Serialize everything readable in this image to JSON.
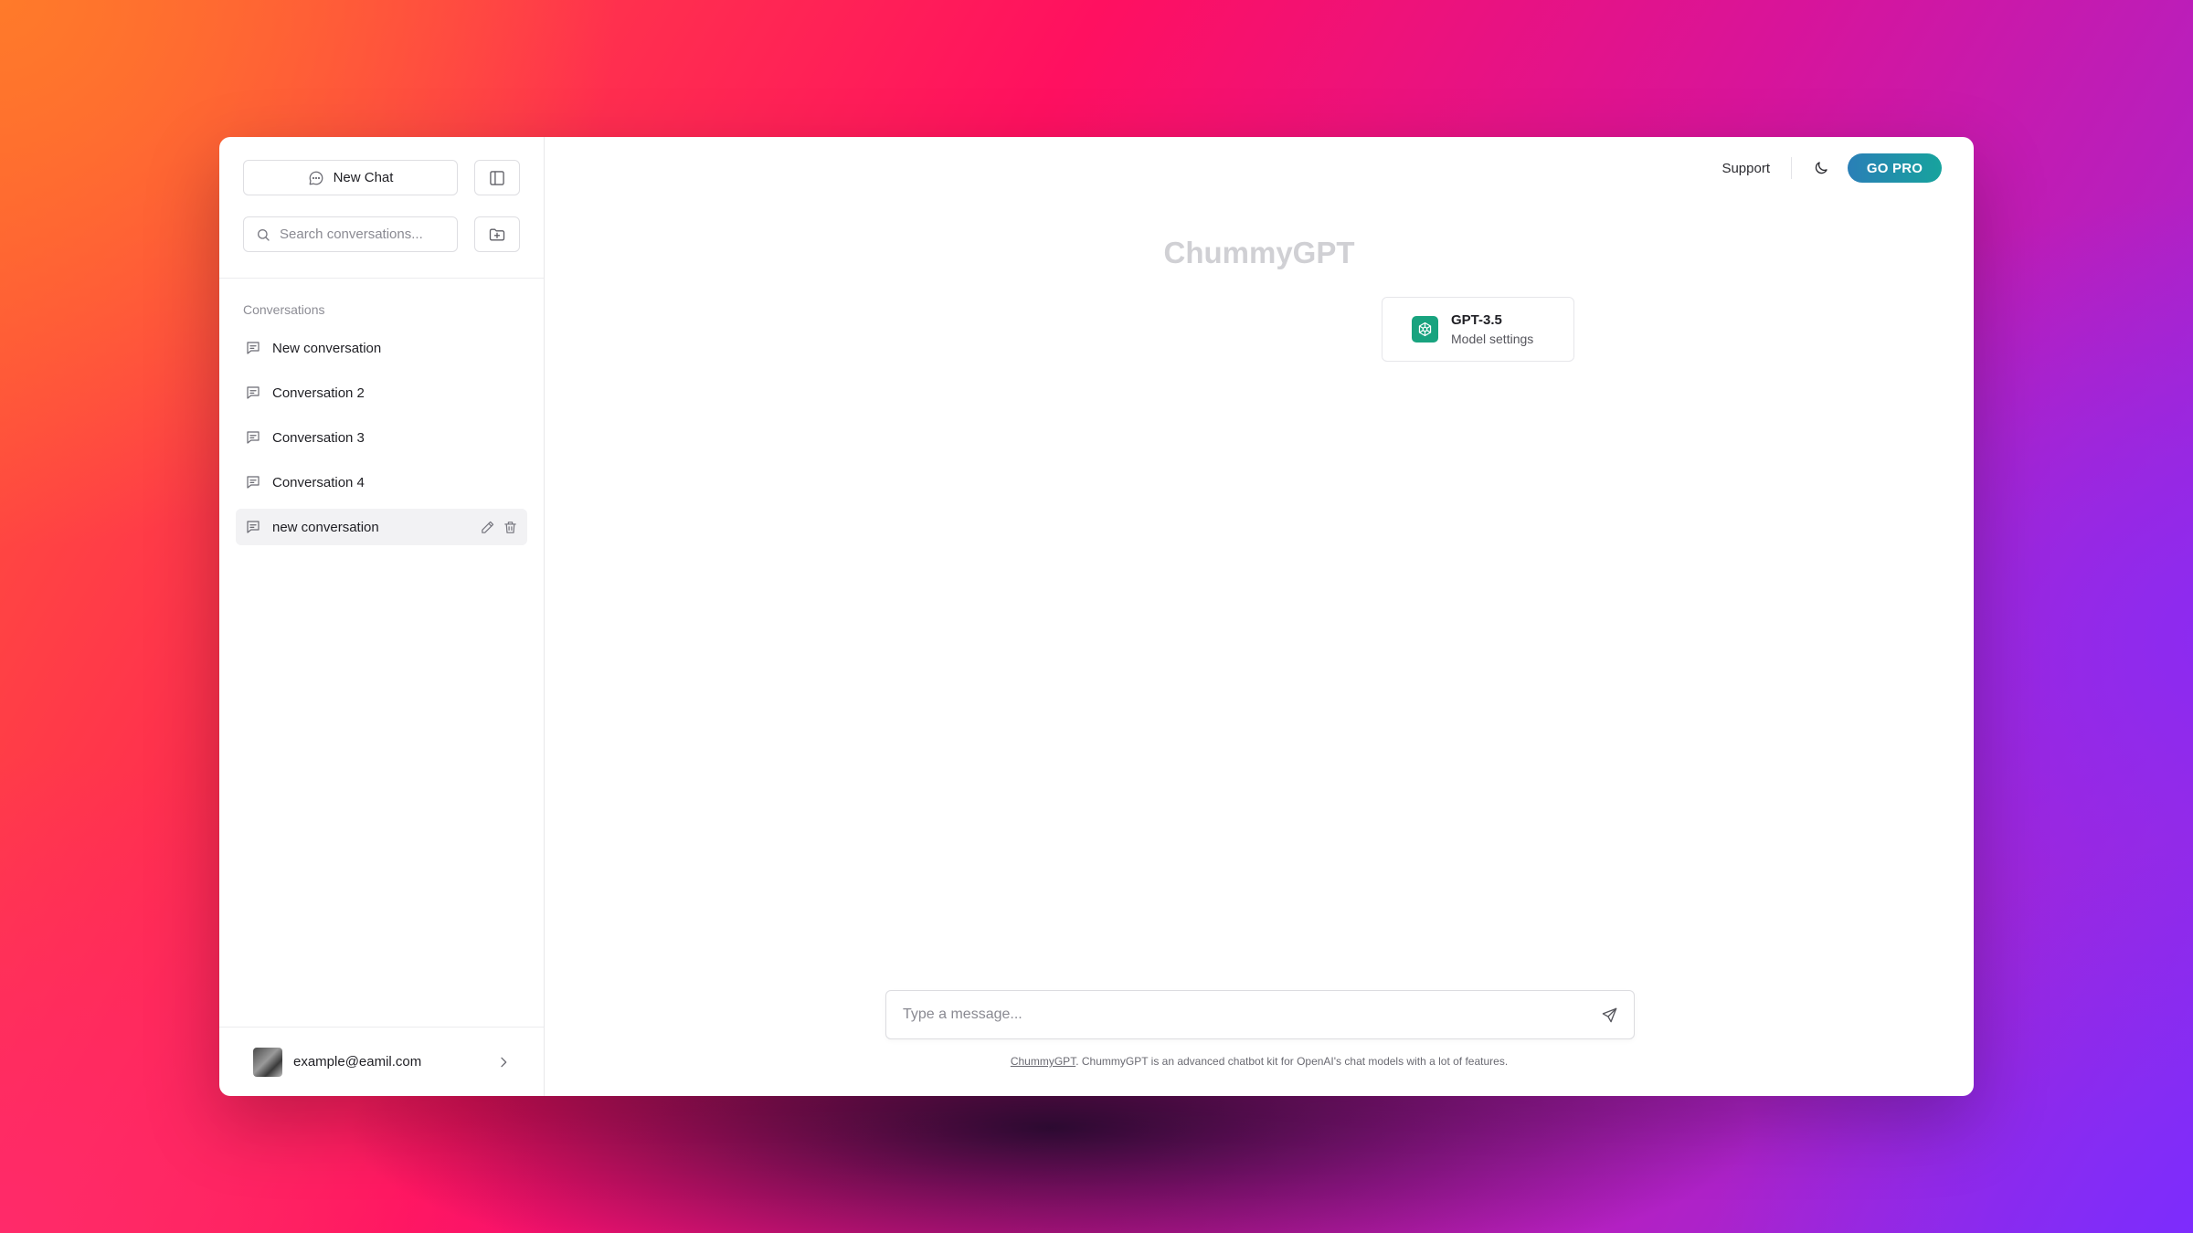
{
  "sidebar": {
    "new_chat_label": "New Chat",
    "search_placeholder": "Search conversations...",
    "conversations_heading": "Conversations",
    "conversations": [
      {
        "label": "New conversation"
      },
      {
        "label": "Conversation 2"
      },
      {
        "label": "Conversation 3"
      },
      {
        "label": "Conversation 4"
      },
      {
        "label": "new conversation",
        "active": true
      }
    ],
    "user_email": "example@eamil.com"
  },
  "header": {
    "support_label": "Support",
    "go_pro_label": "GO PRO"
  },
  "main": {
    "app_title": "ChummyGPT",
    "model_name": "GPT-3.5",
    "model_settings_label": "Model settings",
    "message_placeholder": "Type a message...",
    "footer_link": "ChummyGPT",
    "footer_text": ". ChummyGPT is an advanced chatbot kit for OpenAI's chat models with a lot of features."
  },
  "colors": {
    "go_pro_gradient_start": "#2a7fb7",
    "go_pro_gradient_end": "#17a39d",
    "openai_green": "#19a37f"
  },
  "icons": {
    "new_chat": "chat-bubble-icon",
    "sidebar_toggle": "sidebar-toggle-icon",
    "search": "search-icon",
    "new_folder": "folder-plus-icon",
    "conversation": "message-square-icon",
    "edit": "pencil-icon",
    "delete": "trash-icon",
    "chevron": "chevron-right-icon",
    "theme": "moon-icon",
    "model": "openai-logo-icon",
    "send": "send-icon"
  }
}
